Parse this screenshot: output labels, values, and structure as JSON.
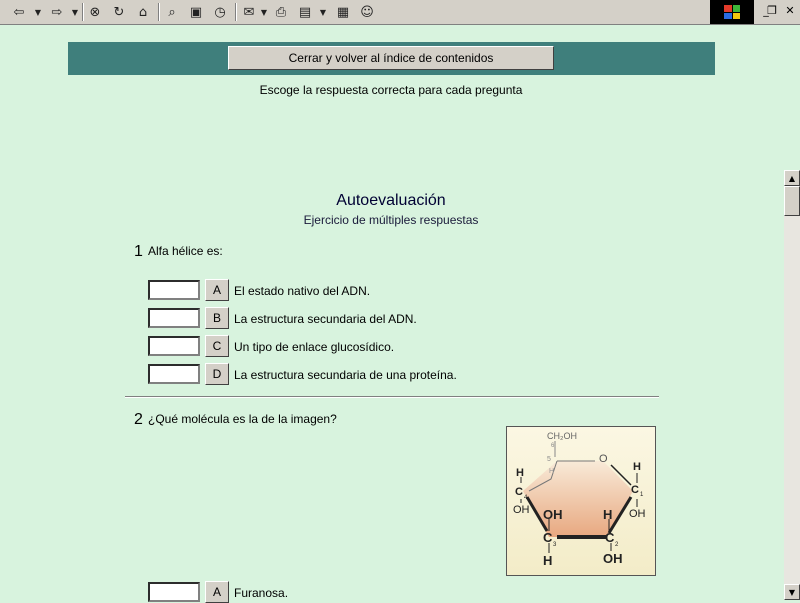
{
  "toolbar": {
    "icons": [
      "back-icon",
      "dropdown-icon",
      "forward-icon",
      "dropdown-icon",
      "stop-icon",
      "refresh-icon",
      "home-icon",
      "search-icon",
      "favorites-icon",
      "history-icon",
      "mail-icon",
      "print-icon",
      "edit-icon",
      "discuss-icon",
      "messenger-icon"
    ]
  },
  "header": {
    "close_button": "Cerrar y volver al índice de contenidos",
    "instructions": "Escoge la respuesta correcta para cada pregunta"
  },
  "quiz": {
    "title": "Autoevaluación",
    "subtitle": "Ejercicio de múltiples respuestas",
    "questions": [
      {
        "number": "1",
        "text": "Alfa hélice es:",
        "options": [
          {
            "letter": "A",
            "text": "El estado nativo del ADN."
          },
          {
            "letter": "B",
            "text": "La estructura secundaria del ADN."
          },
          {
            "letter": "C",
            "text": "Un tipo de enlace glucosídico."
          },
          {
            "letter": "D",
            "text": "La estructura secundaria de una proteína."
          }
        ]
      },
      {
        "number": "2",
        "text": "¿Qué molécula es la de la imagen?",
        "figure_labels": [
          "CH₂OH",
          "6",
          "5",
          "H",
          "O",
          "H",
          "H",
          "C",
          "4",
          "C",
          "1",
          "OH",
          "OH",
          "OH",
          "H",
          "C",
          "3",
          "C",
          "2",
          "H",
          "OH"
        ],
        "options": [
          {
            "letter": "A",
            "text": "Furanosa."
          }
        ]
      }
    ]
  },
  "colors": {
    "background": "#d8f3de",
    "banner": "#3f7f7c",
    "button_face": "#d4d0c8"
  }
}
